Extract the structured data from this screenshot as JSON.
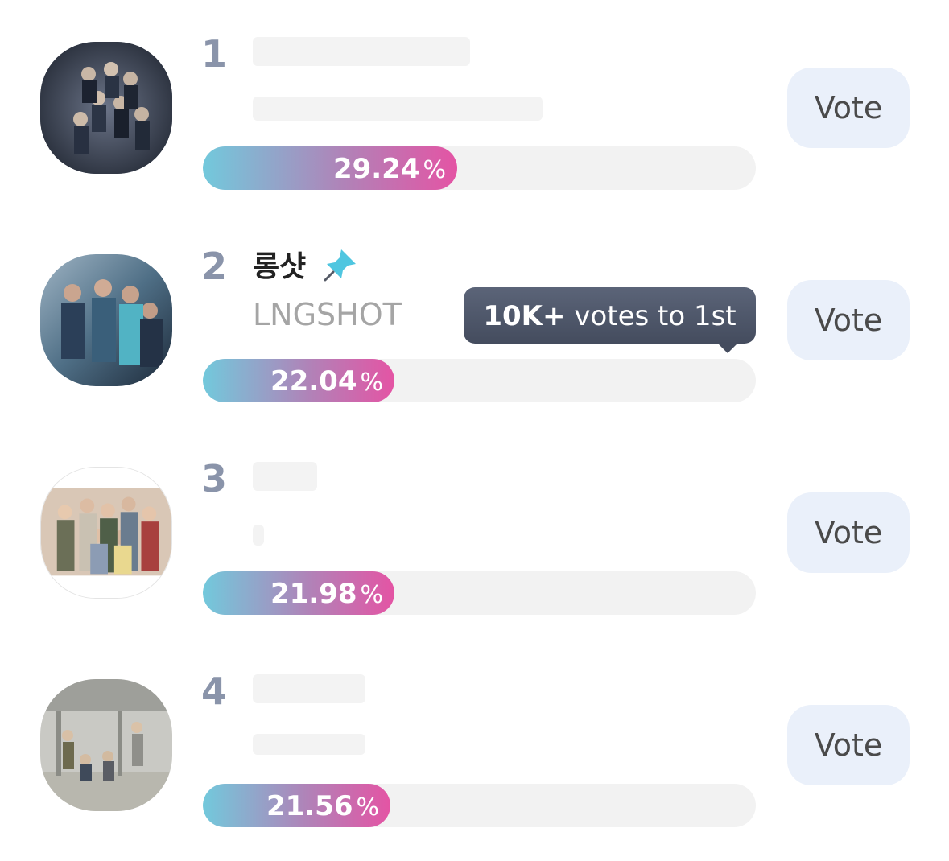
{
  "rankings": [
    {
      "rank": "1",
      "percent": "29.24",
      "percent_symbol": "%",
      "share": 0.2924,
      "vote_label": "Vote"
    },
    {
      "rank": "2",
      "name": "롱샷",
      "subname": "LNGSHOT",
      "percent": "22.04",
      "percent_symbol": "%",
      "share": 0.2204,
      "vote_label": "Vote",
      "pin_icon": "pin-icon",
      "tooltip": {
        "strong": "10K+",
        "text": " votes to 1st"
      }
    },
    {
      "rank": "3",
      "percent": "21.98",
      "percent_symbol": "%",
      "share": 0.2198,
      "vote_label": "Vote"
    },
    {
      "rank": "4",
      "percent": "21.56",
      "percent_symbol": "%",
      "share": 0.2156,
      "vote_label": "Vote"
    }
  ],
  "colors": {
    "bar_start": "#72c9dc",
    "bar_end": "#e454a4",
    "rank": "#8a94aa",
    "vote_bg": "#eaf0fa",
    "tooltip_bg": "#4f5769",
    "pin": "#4fc6e0"
  }
}
